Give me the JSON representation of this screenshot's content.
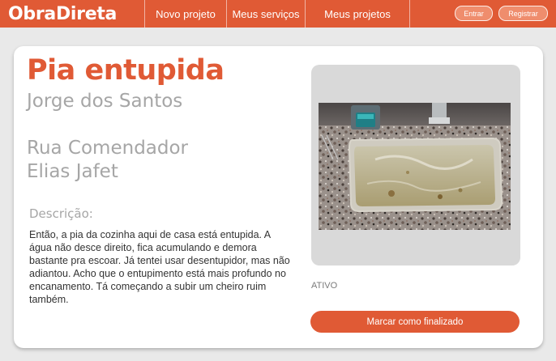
{
  "header": {
    "brand": "ObraDireta",
    "nav": [
      "Novo projeto",
      "Meus serviços",
      "Meus projetos"
    ],
    "login_label": "Entrar",
    "register_label": "Registrar"
  },
  "service": {
    "title": "Pia entupida",
    "client_name": "Jorge dos Santos",
    "address": "Rua Comendador Elias Jafet",
    "description_label": "Descrição:",
    "description": "Então, a pia da cozinha aqui de casa está entupida. A água não desce direito, fica acumulando e demora bastante pra escoar. Já tentei usar desentupidor, mas não adiantou. Acho que o entupimento está mais profundo no encanamento. Tá começando a subir um cheiro ruim também.",
    "status": "ATIVO",
    "finish_button_label": "Marcar como finalizado"
  },
  "colors": {
    "brand": "#e05a35",
    "muted_text": "#a6a6a6",
    "background": "#e9e9e9"
  }
}
